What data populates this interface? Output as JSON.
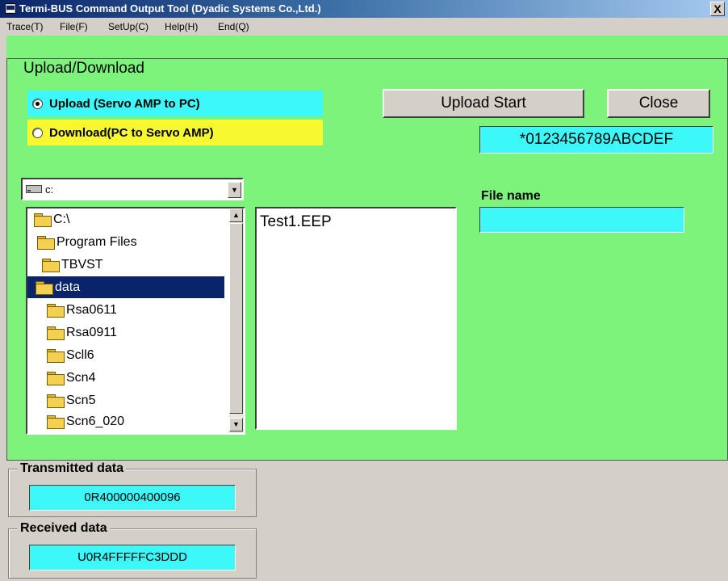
{
  "window": {
    "title": "Termi-BUS Command Output Tool (Dyadic Systems Co.,Ltd.)",
    "close_label": "X"
  },
  "menu": [
    {
      "label": "Trace(T)"
    },
    {
      "label": "File(F)"
    },
    {
      "label": "SetUp(C)"
    },
    {
      "label": "Help(H)"
    },
    {
      "label": "End(Q)"
    }
  ],
  "transfer": {
    "group_title": "Upload/Download",
    "upload_label": "Upload  (Servo AMP to PC)",
    "download_label": "Download(PC to Servo AMP)",
    "selected": "upload",
    "upload_start_label": "Upload Start",
    "close_label": "Close",
    "hex_display": "*0123456789ABCDEF",
    "file_name_label": "File name",
    "file_name_value": "",
    "colors": {
      "panel": "#7cf47c",
      "upload_highlight": "#3cf8f8",
      "download_highlight": "#f8f830",
      "field": "#3cf8f8"
    }
  },
  "drive": {
    "value": "c:",
    "icon": "drive-icon"
  },
  "folders": [
    {
      "label": "C:\\",
      "icon": "folder-open-icon"
    },
    {
      "label": "Program Files",
      "icon": "folder-open-icon"
    },
    {
      "label": "TBVST",
      "icon": "folder-open-icon"
    },
    {
      "label": "data",
      "icon": "folder-open-icon",
      "selected": true
    },
    {
      "label": "Rsa0611",
      "icon": "folder-closed-icon"
    },
    {
      "label": "Rsa0911",
      "icon": "folder-closed-icon"
    },
    {
      "label": "Scll6",
      "icon": "folder-closed-icon"
    },
    {
      "label": "Scn4",
      "icon": "folder-closed-icon"
    },
    {
      "label": "Scn5",
      "icon": "folder-closed-icon"
    },
    {
      "label": "Scn6_020",
      "icon": "folder-closed-icon"
    }
  ],
  "files": [
    {
      "label": "Test1.EEP"
    }
  ],
  "transmitted": {
    "label": "Transmitted data",
    "value": "0R400000400096"
  },
  "received": {
    "label": "Received data",
    "value": "U0R4FFFFFC3DDD"
  }
}
